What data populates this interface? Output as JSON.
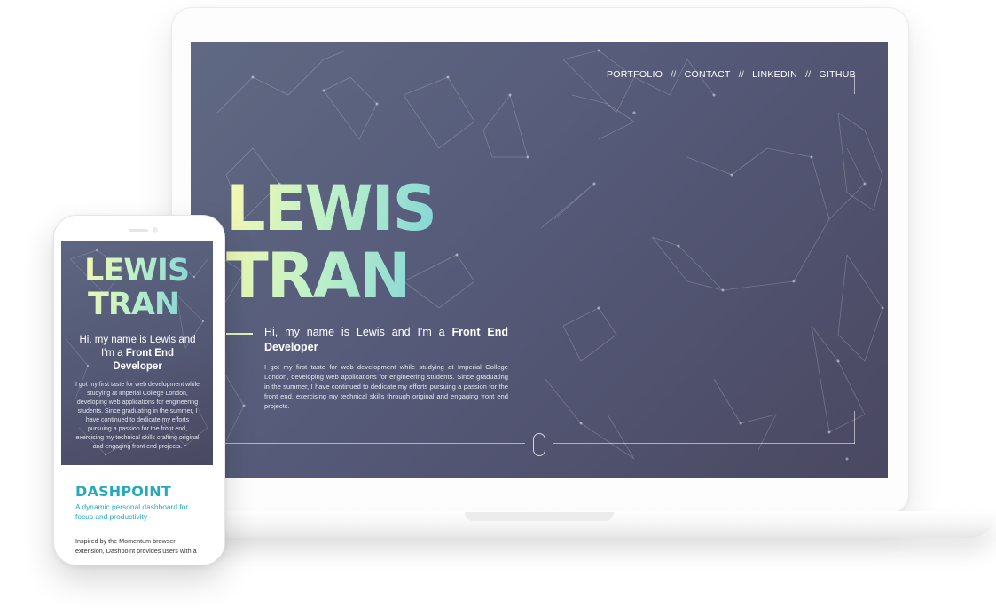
{
  "desktop": {
    "nav": [
      {
        "label": "PORTFOLIO"
      },
      {
        "label": "CONTACT"
      },
      {
        "label": "LINKEDIN"
      },
      {
        "label": "GITHUB"
      }
    ],
    "nav_separator": "//",
    "hero": {
      "first_name": "LEWIS",
      "last_name": "TRAN",
      "intro_prefix": "Hi, my name is Lewis and I'm a ",
      "intro_highlight": "Front End Developer",
      "bio": "I got my first taste for web development while studying at Imperial College London, developing web applications for engineering students. Since graduating in the summer, I have continued to dedicate my efforts pursuing a passion for the front end, exercising my technical skills through original and engaging front end projects."
    }
  },
  "mobile": {
    "hero": {
      "first_name": "LEWIS",
      "last_name": "TRAN",
      "intro_prefix": "Hi, my name is Lewis and I'm a ",
      "intro_highlight": "Front End Developer",
      "bio": "I got my first taste for web development while studying at Imperial College London, developing web applications for engineering students. Since graduating in the summer, I have continued to dedicate my efforts pursuing a passion for the front end, exercising my technical skills crafting original and engaging front end projects."
    },
    "project": {
      "title": "DASHPOINT",
      "subtitle": "A dynamic personal dashboard for focus and productivity",
      "description": "Inspired by the Momentum browser extension, Dashpoint provides users with a stylish, yet"
    }
  },
  "colors": {
    "hero_gradient_start": "#606983",
    "hero_gradient_end": "#4a4862",
    "name_gradient": [
      "#f6f8b0",
      "#bff1c8",
      "#7fd4d8"
    ],
    "accent_teal": "#26a9bb"
  }
}
